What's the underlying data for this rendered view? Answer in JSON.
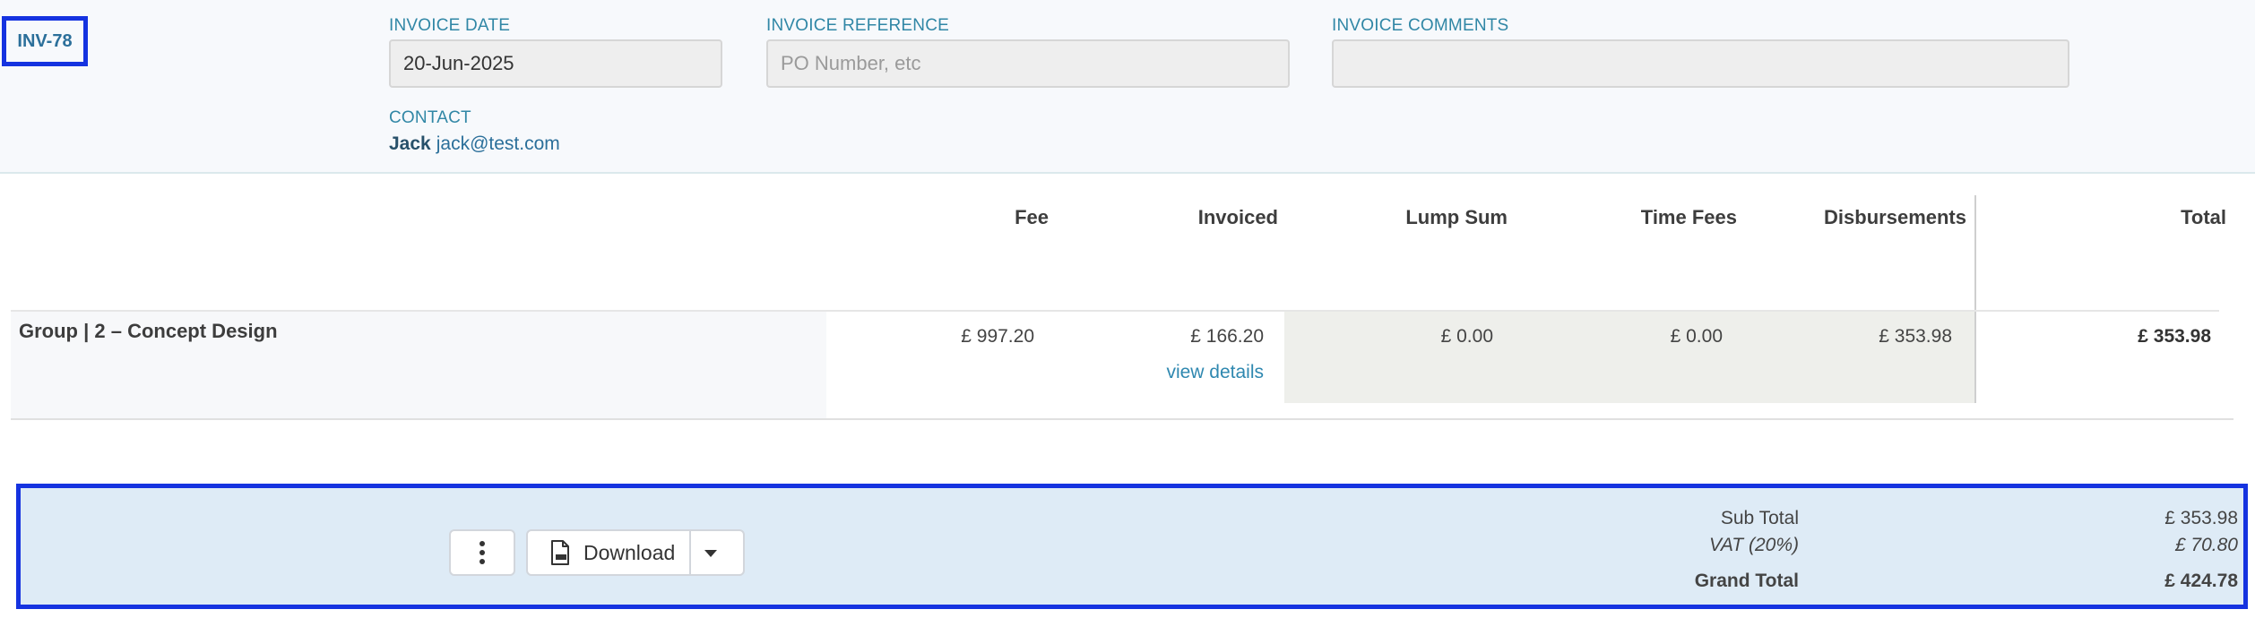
{
  "invoice": {
    "id": "INV-78",
    "date_label": "INVOICE DATE",
    "date_value": "20-Jun-2025",
    "reference_label": "INVOICE REFERENCE",
    "reference_placeholder": "PO Number, etc",
    "comments_label": "INVOICE COMMENTS",
    "comments_value": "",
    "contact_label": "CONTACT",
    "contact_name": "Jack",
    "contact_email": "jack@test.com"
  },
  "table": {
    "columns": [
      "Fee",
      "Invoiced",
      "Lump Sum",
      "Time Fees",
      "Disbursements",
      "Total"
    ],
    "rows": [
      {
        "label": "Group | 2 – Concept Design",
        "fee": "£ 997.20",
        "invoiced": "£ 166.20",
        "view_details": "view details",
        "lump_sum": "£ 0.00",
        "time_fees": "£ 0.00",
        "disbursements": "£ 353.98",
        "total": "£ 353.98"
      }
    ]
  },
  "footer": {
    "download_label": "Download",
    "sub_total_label": "Sub Total",
    "sub_total_value": "£ 353.98",
    "vat_label": "VAT (20%)",
    "vat_value": "£ 70.80",
    "grand_total_label": "Grand Total",
    "grand_total_value": "£ 424.78"
  },
  "colors": {
    "accent": "#1533e0",
    "label_blue": "#3187a6",
    "link_blue": "#2f88b0",
    "footer_bg": "#deebf6"
  },
  "icons": {
    "more": "vertical-dots-icon",
    "pdf": "pdf-file-icon",
    "caret": "caret-down-icon"
  }
}
